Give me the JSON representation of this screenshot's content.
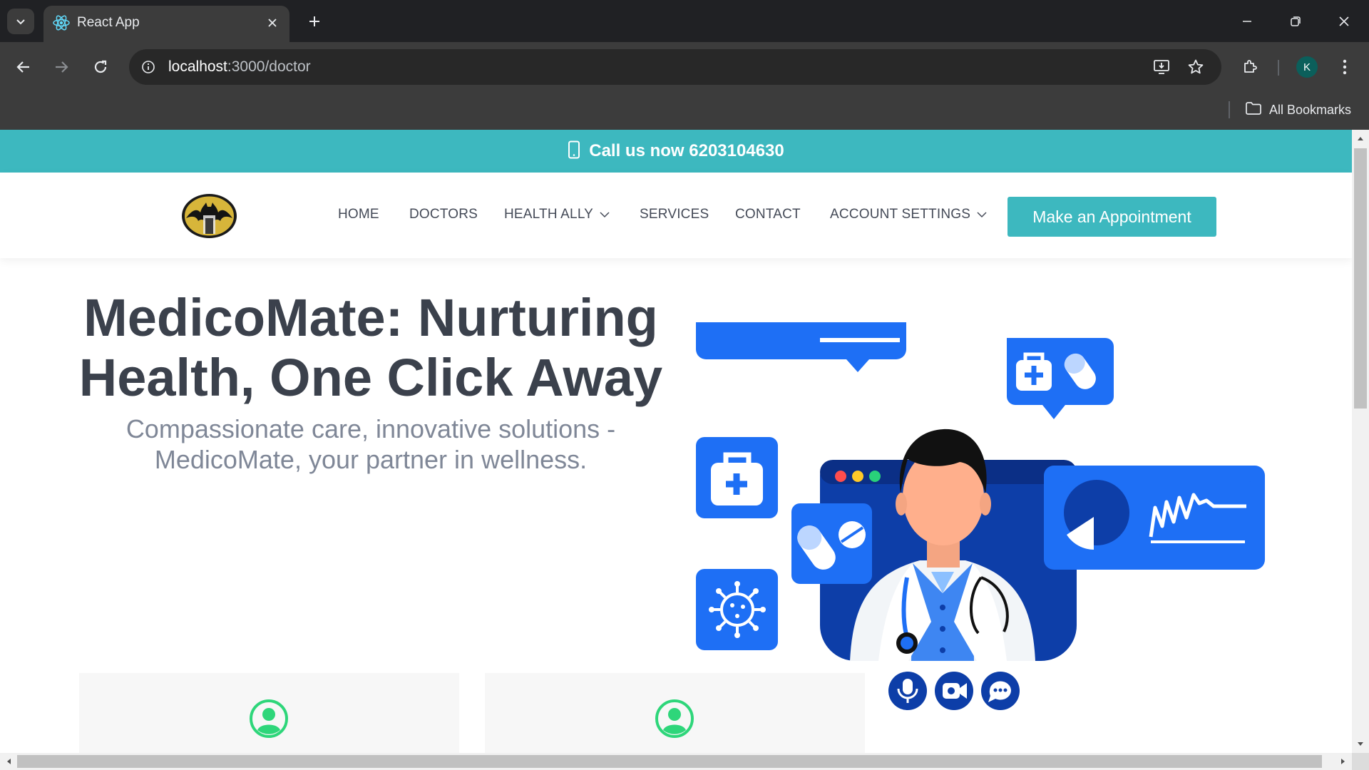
{
  "browser": {
    "tab_title": "React App",
    "url_host": "localhost",
    "url_path": ":3000/doctor",
    "profile_initial": "K",
    "bookmarks_label": "All Bookmarks",
    "icons": [
      "tab-search-icon",
      "react-favicon-icon",
      "close-icon",
      "plus-icon",
      "minimize-icon",
      "restore-icon",
      "close-window-icon",
      "back-icon",
      "forward-icon",
      "reload-icon",
      "site-info-icon",
      "install-app-icon",
      "star-icon",
      "extensions-icon",
      "menu-icon",
      "folder-icon"
    ]
  },
  "page": {
    "topbar": {
      "text": "Call us now 6203104630",
      "icon": "mobile-phone-icon",
      "color": "#3db8bf"
    },
    "nav": {
      "items": [
        {
          "label": "HOME"
        },
        {
          "label": "DOCTORS"
        },
        {
          "label": "HEALTH ALLY",
          "dropdown": true
        },
        {
          "label": "SERVICES"
        },
        {
          "label": "CONTACT"
        },
        {
          "label": "ACCOUNT SETTINGS",
          "dropdown": true
        }
      ],
      "cta_label": "Make an Appointment"
    },
    "hero": {
      "title": "MedicoMate: Nurturing Health, One Click Away",
      "subtitle": "Compassionate care, innovative solutions - MedicoMate, your partner in wellness."
    },
    "cards": [
      {
        "icon": "user-circle-icon"
      },
      {
        "icon": "user-circle-icon"
      }
    ],
    "colors": {
      "accent": "#3db8bf",
      "illustration_blue": "#1e6ff5",
      "dark_blue": "#0d3ea8",
      "heading": "#3b414c",
      "subtext": "#7f8797",
      "card_icon": "#2ed67a"
    }
  }
}
